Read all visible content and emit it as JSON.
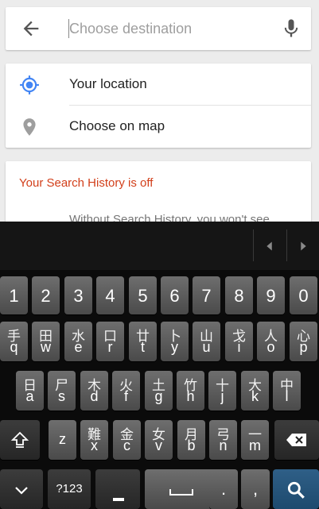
{
  "search": {
    "placeholder": "Choose destination",
    "value": ""
  },
  "options": [
    {
      "label": "Your location",
      "icon": "my-location-icon"
    },
    {
      "label": "Choose on map",
      "icon": "map-pin-icon"
    }
  ],
  "history": {
    "title": "Your Search History is off",
    "body": "Without Search History, you won't see"
  },
  "colors": {
    "accent": "#4285f4",
    "warning": "#d23f1a",
    "go_key": "#1d4a6e"
  },
  "keyboard": {
    "numbers": [
      "1",
      "2",
      "3",
      "4",
      "5",
      "6",
      "7",
      "8",
      "9",
      "0"
    ],
    "row1": [
      {
        "c": "手",
        "l": "q"
      },
      {
        "c": "田",
        "l": "w"
      },
      {
        "c": "水",
        "l": "e"
      },
      {
        "c": "口",
        "l": "r"
      },
      {
        "c": "廿",
        "l": "t"
      },
      {
        "c": "卜",
        "l": "y"
      },
      {
        "c": "山",
        "l": "u"
      },
      {
        "c": "戈",
        "l": "i"
      },
      {
        "c": "人",
        "l": "o"
      },
      {
        "c": "心",
        "l": "p"
      }
    ],
    "row2": [
      {
        "c": "日",
        "l": "a"
      },
      {
        "c": "尸",
        "l": "s"
      },
      {
        "c": "木",
        "l": "d"
      },
      {
        "c": "火",
        "l": "f"
      },
      {
        "c": "土",
        "l": "g"
      },
      {
        "c": "竹",
        "l": "h"
      },
      {
        "c": "十",
        "l": "j"
      },
      {
        "c": "大",
        "l": "k"
      },
      {
        "c": "中",
        "l": "l"
      }
    ],
    "row3": [
      {
        "c": "",
        "l": "z"
      },
      {
        "c": "難",
        "l": "x"
      },
      {
        "c": "金",
        "l": "c"
      },
      {
        "c": "女",
        "l": "v"
      },
      {
        "c": "月",
        "l": "b"
      },
      {
        "c": "弓",
        "l": "n"
      },
      {
        "c": "一",
        "l": "m"
      }
    ],
    "symbols_label": "?123",
    "period": ".",
    "comma": ","
  }
}
